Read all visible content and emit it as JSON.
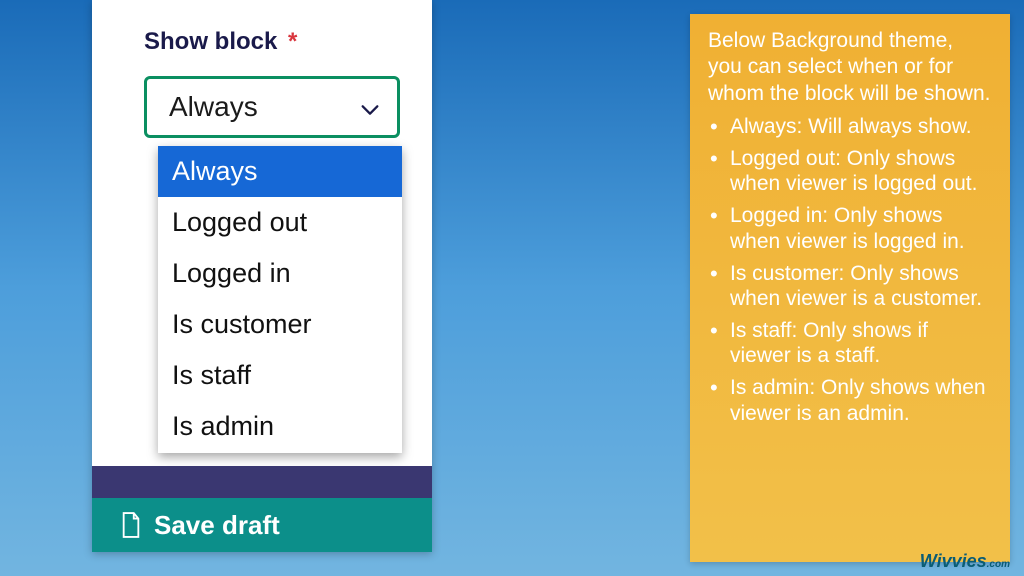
{
  "field": {
    "label": "Show block",
    "required_mark": "*",
    "selected": "Always",
    "options": [
      "Always",
      "Logged out",
      "Logged in",
      "Is customer",
      "Is staff",
      "Is admin"
    ]
  },
  "save_button": "Save draft",
  "info": {
    "lead": "Below Background theme, you can select when or for whom the block will be shown.",
    "bullets": [
      "Always: Will always show.",
      "Logged out: Only shows when viewer is logged out.",
      "Logged in: Only shows when viewer is logged in.",
      "Is customer: Only shows when viewer is a customer.",
      "Is staff: Only shows if viewer is a staff.",
      "Is admin: Only shows when viewer is an admin."
    ]
  },
  "brand": {
    "name": "Wivvies",
    "ext": ".com"
  }
}
